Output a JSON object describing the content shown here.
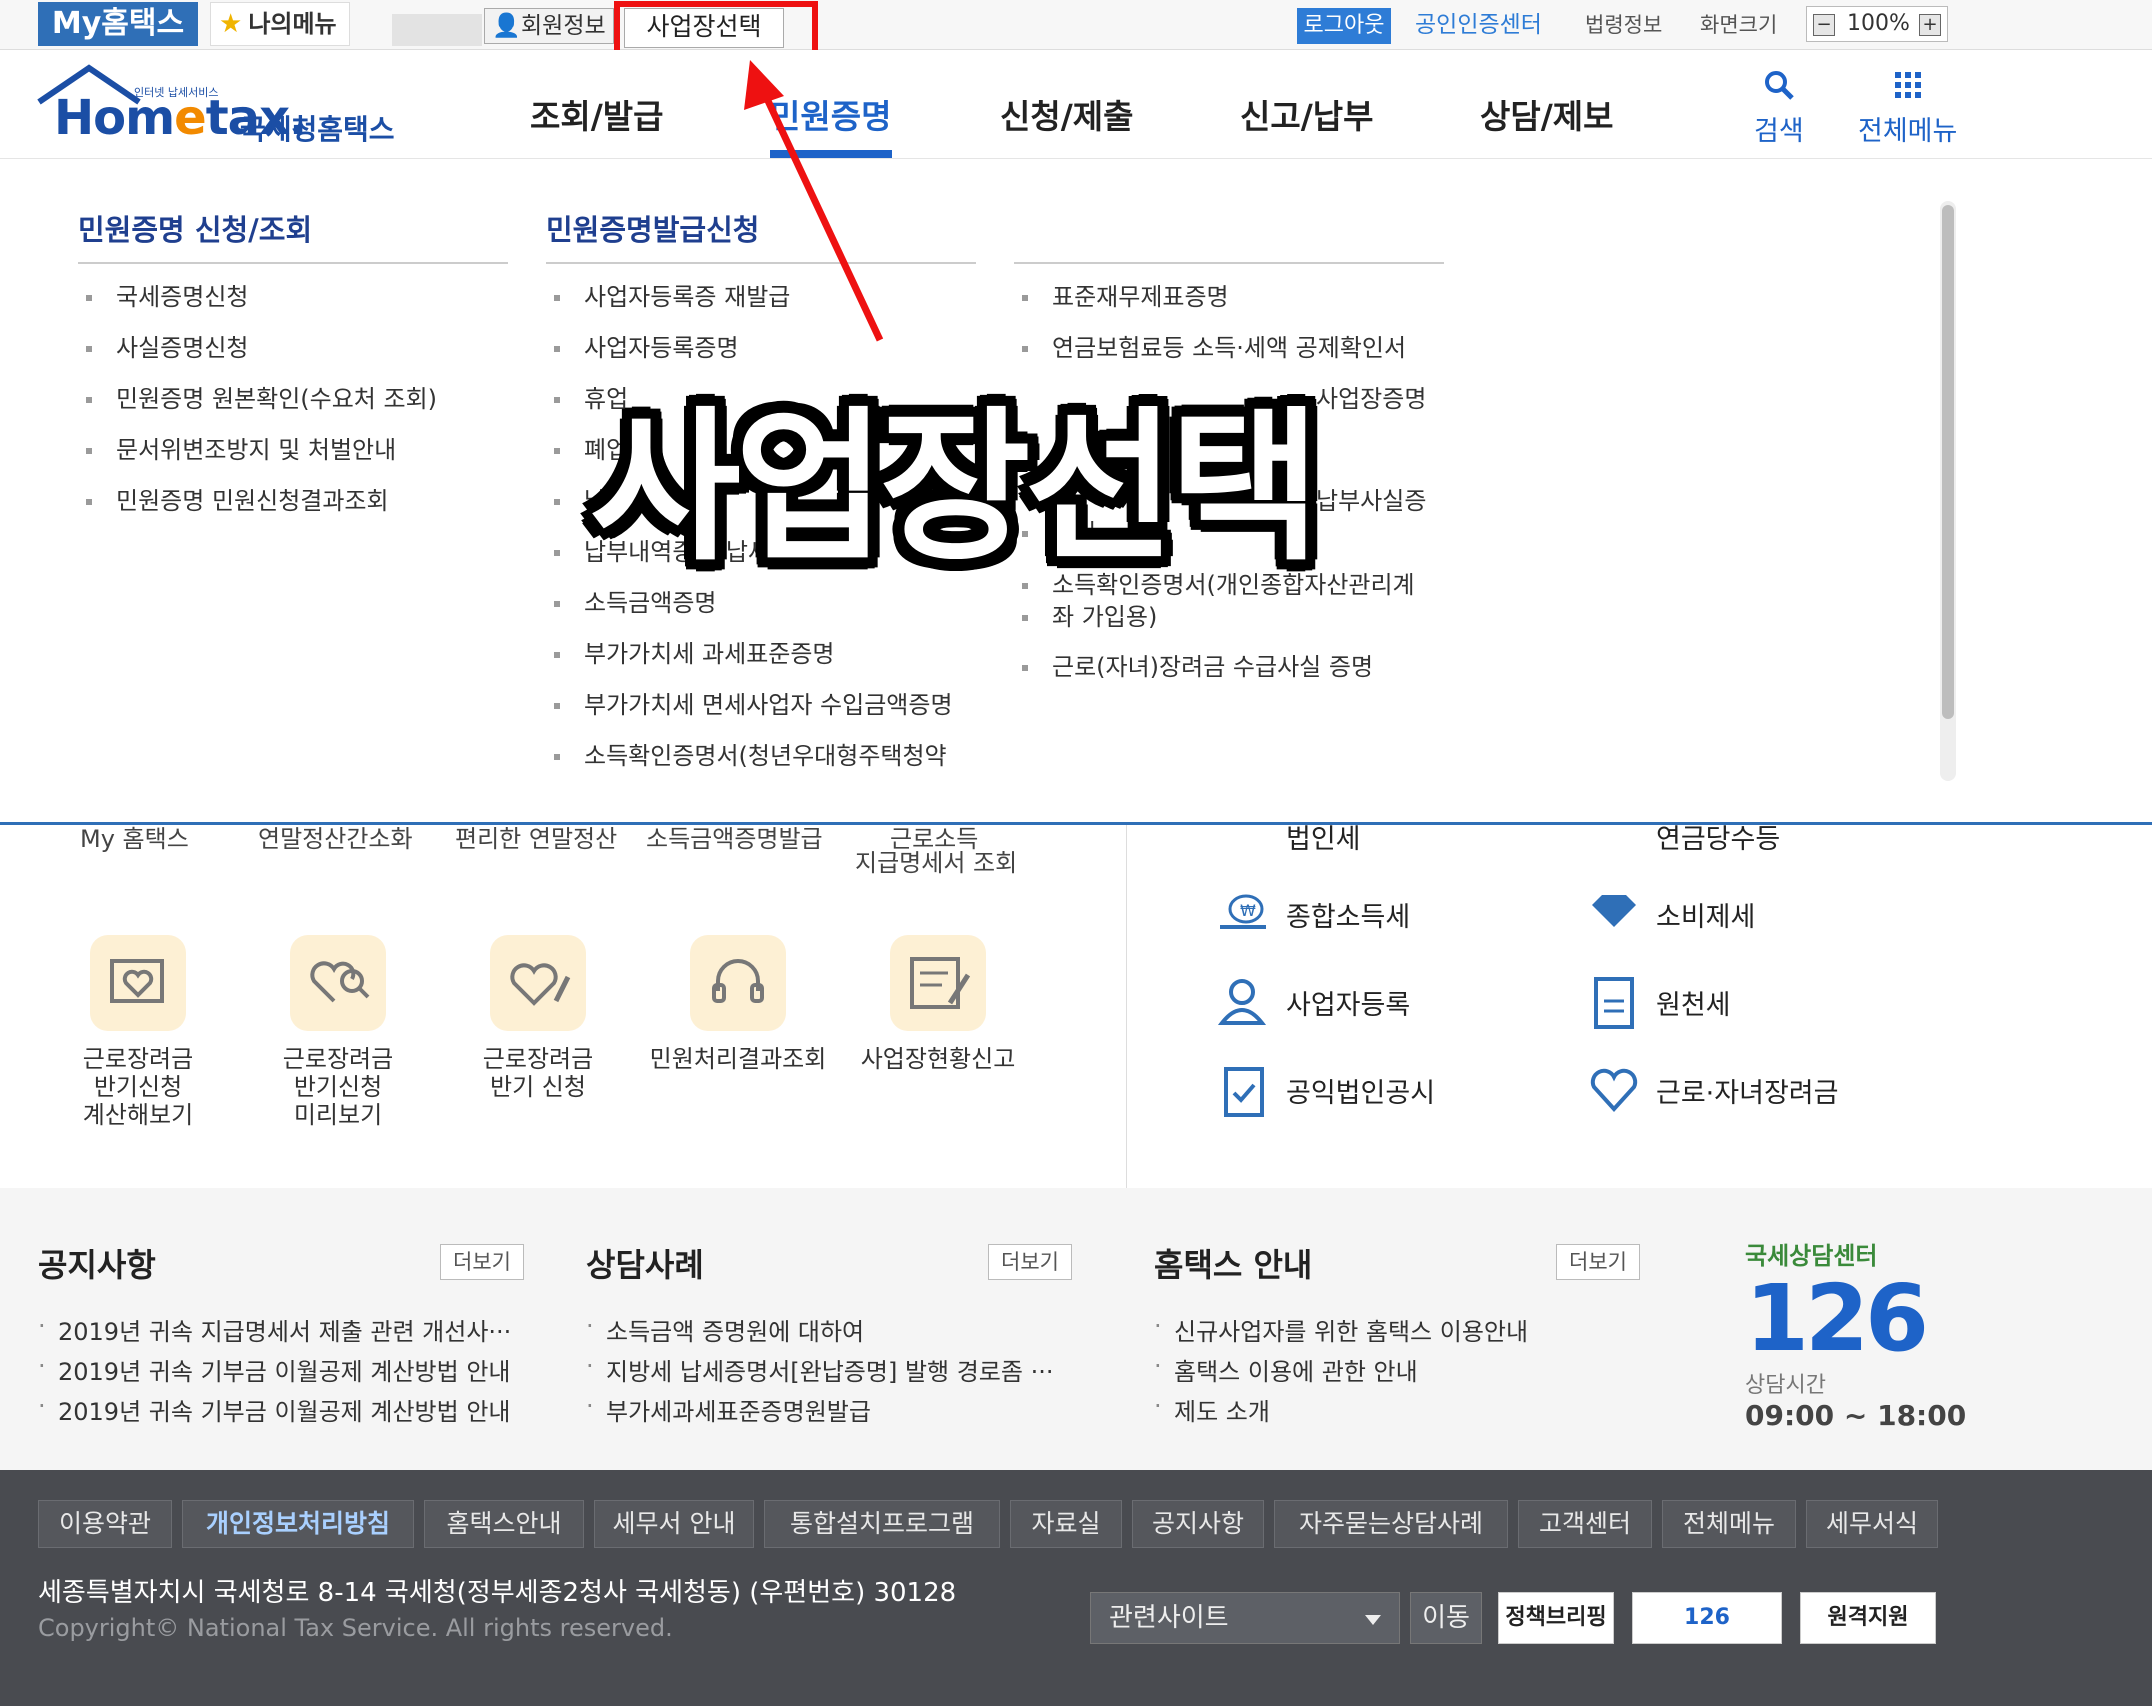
{
  "topbar": {
    "myhometax": "My홈택스",
    "mymenu": "나의메뉴",
    "member_info": "회원정보",
    "select_workplace": "사업장선택",
    "logout": "로그아웃",
    "cert_center": "공인인증센터",
    "law_info": "법령정보",
    "screen_size": "화면크기",
    "zoom_minus": "−",
    "zoom_value": "100%",
    "zoom_plus": "+"
  },
  "header": {
    "logo_tiny": "인터넷 납세서비스",
    "logo_brand_a": "Hom",
    "logo_brand_e": "e",
    "logo_brand_b": "tax.",
    "logo_korean": "국세청홈택스",
    "gnb": [
      "조회/발급",
      "민원증명",
      "신청/제출",
      "신고/납부",
      "상담/제보"
    ],
    "active_gnb_index": 1,
    "search_label": "검색",
    "allmenu_label": "전체메뉴"
  },
  "dropdown": {
    "col1_title": "민원증명 신청/조회",
    "col1_items": [
      "국세증명신청",
      "사실증명신청",
      "민원증명 원본확인(수요처 조회)",
      "문서위변조방지 및 처벌안내",
      "민원증명 민원신청결과조회"
    ],
    "col2_title": "민원증명발급신청",
    "col2_items": [
      "사업자등록증 재발급",
      "사업자등록증명",
      "휴업",
      "폐업",
      "납",
      "납부내역증명(납세사실증명)",
      "소득금액증명",
      "부가가치세 과세표준증명",
      "부가가치세 면세사업자 수입금액증명",
      "소득확인증명서(청년우대형주택청약"
    ],
    "col3_items": [
      "표준재무제표증명",
      "연금보험료등 소득·세액 공제확인서",
      "사업장증명",
      "납부사실증",
      "명서",
      "소득확인증명서(개인종합자산관리계",
      "좌 가입용)",
      "근로(자녀)장려금 수급사실 증명"
    ]
  },
  "overlay_caption": "사업장선택",
  "body": {
    "cut_labels": [
      "My 홈택스",
      "연말정산간소화",
      "편리한 연말정산",
      "소득금액증명발급",
      "근로소득",
      "지급명세서 조회"
    ],
    "services": [
      {
        "icon": "heart-document-icon",
        "lines": [
          "근로장려금",
          "반기신청",
          "계산해보기"
        ]
      },
      {
        "icon": "heart-search-icon",
        "lines": [
          "근로장려금",
          "반기신청",
          "미리보기"
        ]
      },
      {
        "icon": "heart-pen-icon",
        "lines": [
          "근로장려금",
          "반기 신청"
        ]
      },
      {
        "icon": "headset-icon",
        "lines": [
          "민원처리결과조회"
        ]
      },
      {
        "icon": "form-pen-icon",
        "lines": [
          "사업장현황신고"
        ]
      }
    ],
    "tax_cut_left": "법인세",
    "tax_cut_right": "연금당수등",
    "taxes": [
      {
        "icon": "money-hand-icon",
        "label": "종합소득세"
      },
      {
        "icon": "diamond-icon",
        "label": "소비제세"
      },
      {
        "icon": "person-icon",
        "label": "사업자등록"
      },
      {
        "icon": "salary-doc-icon",
        "label": "원천세"
      },
      {
        "icon": "clipboard-check-icon",
        "label": "공익법인공시"
      },
      {
        "icon": "heart-sprout-icon",
        "label": "근로·자녀장려금"
      }
    ]
  },
  "boards": {
    "more": "더보기",
    "notice": {
      "title": "공지사항",
      "items": [
        "2019년 귀속 지급명세서 제출 관련 개선사···",
        "2019년 귀속 기부금 이월공제 계산방법 안내",
        "2019년 귀속 기부금 이월공제 계산방법 안내"
      ]
    },
    "consult": {
      "title": "상담사례",
      "items": [
        "소득금액 증명원에 대하여",
        "지방세 납세증명서[완납증명] 발행 경로좀 ···",
        "부가세과세표준증명원발급"
      ]
    },
    "guide": {
      "title": "홈택스 안내",
      "items": [
        "신규사업자를 위한 홈택스 이용안내",
        "홈택스 이용에 관한 안내",
        "제도 소개"
      ]
    },
    "callcenter": {
      "title": "국세상담센터",
      "number": "126",
      "hours_label": "상담시간",
      "hours": "09:00 ~ 18:00"
    }
  },
  "footer": {
    "links": [
      "이용약관",
      "개인정보처리방침",
      "홈택스안내",
      "세무서 안내",
      "통합설치프로그램",
      "자료실",
      "공지사항",
      "자주묻는상담사례",
      "고객센터",
      "전체메뉴",
      "세무서식"
    ],
    "address": "세종특별자치시 국세청로 8-14 국세청(정부세종2청사 국세청동) (우편번호) 30128",
    "copyright": "Copyright© National Tax Service. All rights reserved.",
    "related_site": "관련사이트",
    "move": "이동",
    "btn_policy": "정책브리핑",
    "btn_126": "126",
    "btn_remote": "원격지원"
  },
  "colors": {
    "brand_blue": "#1e63c8",
    "highlight_red": "#ee1111",
    "footer_bg": "#494b50"
  }
}
